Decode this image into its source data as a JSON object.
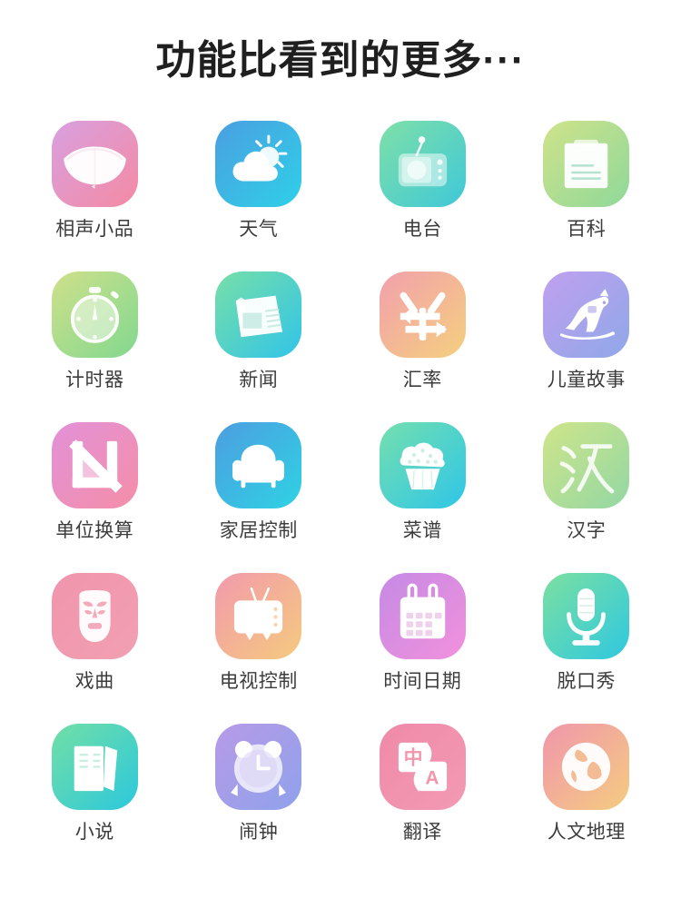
{
  "header": {
    "title": "功能比看到的更多···"
  },
  "grid": {
    "columns": 4,
    "rows": 5,
    "apps": [
      {
        "label": "相声小品",
        "icon": "fan-icon",
        "from": "#d9a0e0",
        "to": "#f48aa3"
      },
      {
        "label": "天气",
        "icon": "cloud-sun-icon",
        "from": "#4a9fe0",
        "to": "#2fd0e8"
      },
      {
        "label": "电台",
        "icon": "radio-icon",
        "from": "#7fe0a8",
        "to": "#3fc8d8"
      },
      {
        "label": "百科",
        "icon": "document-icon",
        "from": "#cfe38a",
        "to": "#8fd89a"
      },
      {
        "label": "计时器",
        "icon": "stopwatch-icon",
        "from": "#cfe08a",
        "to": "#82d890"
      },
      {
        "label": "新闻",
        "icon": "newspaper-icon",
        "from": "#77dfa8",
        "to": "#31c4e8"
      },
      {
        "label": "汇率",
        "icon": "yuan-swap-icon",
        "from": "#f2a0ad",
        "to": "#f5cf7e"
      },
      {
        "label": "儿童故事",
        "icon": "rocking-horse-icon",
        "from": "#c0a0ef",
        "to": "#8fa8e8"
      },
      {
        "label": "单位换算",
        "icon": "unit-n-icon",
        "from": "#e290d8",
        "to": "#f58fa8"
      },
      {
        "label": "家居控制",
        "icon": "armchair-icon",
        "from": "#4c9ee0",
        "to": "#2fd2e4"
      },
      {
        "label": "菜谱",
        "icon": "cupcake-icon",
        "from": "#74dfae",
        "to": "#2fc6e8"
      },
      {
        "label": "汉字",
        "icon": "hanzi-icon",
        "from": "#cfe58a",
        "to": "#93d7a4"
      },
      {
        "label": "戏曲",
        "icon": "opera-mask-icon",
        "from": "#f095ad",
        "to": "#f29fb2"
      },
      {
        "label": "电视控制",
        "icon": "tv-icon",
        "from": "#f29aac",
        "to": "#f5ca7e"
      },
      {
        "label": "时间日期",
        "icon": "calendar-icon",
        "from": "#c58ae5",
        "to": "#f291dc"
      },
      {
        "label": "脱口秀",
        "icon": "microphone-icon",
        "from": "#7ce0a0",
        "to": "#2fc8e0"
      },
      {
        "label": "小说",
        "icon": "books-icon",
        "from": "#72dfa6",
        "to": "#2cc8dc"
      },
      {
        "label": "闹钟",
        "icon": "alarm-clock-icon",
        "from": "#b79ae8",
        "to": "#8fa2ea"
      },
      {
        "label": "翻译",
        "icon": "translate-icon",
        "from": "#f08aa8",
        "to": "#f29ab4"
      },
      {
        "label": "人文地理",
        "icon": "globe-icon",
        "from": "#f096ac",
        "to": "#f5cc80"
      }
    ]
  },
  "colors": {
    "background": "#ffffff",
    "title_text": "#1f1f1f",
    "label_text": "#3c3c3c",
    "icon_glyph": "#ffffff"
  }
}
